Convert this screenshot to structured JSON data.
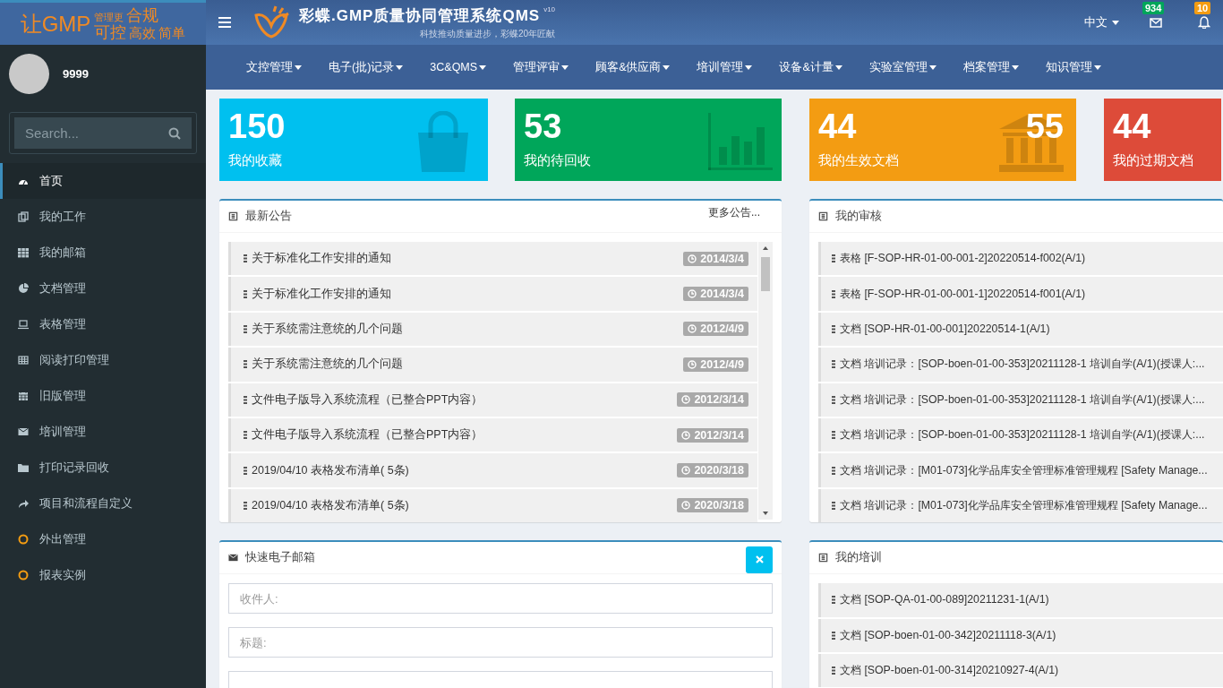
{
  "header": {
    "logo": {
      "lead": "让GMP",
      "small": "管理更",
      "big": "合规",
      "words": [
        "可控",
        "高效",
        "简单"
      ]
    },
    "app_title": "彩蝶.GMP质量协同管理系统QMS",
    "version": "v10",
    "slogan": "科技推动质量进步，彩蝶20年匠献",
    "language": "中文",
    "mail_count": "934",
    "alert_count": "10"
  },
  "user": {
    "name": "9999"
  },
  "search": {
    "placeholder": "Search..."
  },
  "sidebar": {
    "items": [
      {
        "label": "首页",
        "selected": true
      },
      {
        "label": "我的工作",
        "selected": false
      },
      {
        "label": "我的邮箱",
        "selected": false
      },
      {
        "label": "文档管理",
        "selected": false
      },
      {
        "label": "表格管理",
        "selected": false
      },
      {
        "label": "阅读打印管理",
        "selected": false
      },
      {
        "label": "旧版管理",
        "selected": false
      },
      {
        "label": "培训管理",
        "selected": false
      },
      {
        "label": "打印记录回收",
        "selected": false
      },
      {
        "label": "项目和流程自定义",
        "selected": false
      },
      {
        "label": "外出管理",
        "selected": false
      },
      {
        "label": "报表实例",
        "selected": false
      }
    ]
  },
  "nav": {
    "items": [
      "文控管理",
      "电子(批)记录",
      "3C&QMS",
      "管理评审",
      "顾客&供应商",
      "培训管理",
      "设备&计量",
      "实验室管理",
      "档案管理",
      "知识管理"
    ]
  },
  "stats": [
    {
      "value": "150",
      "label": "我的收藏",
      "color": "#00c0ef"
    },
    {
      "value": "53",
      "label": "我的待回收",
      "color": "#00a65a"
    },
    {
      "value": "44",
      "extra": "55",
      "label": "我的生效文档",
      "color": "#f39c12"
    },
    {
      "value": "44",
      "label": "我的过期文档",
      "color": "#dd4b39"
    }
  ],
  "announcements": {
    "title": "最新公告",
    "more": "更多公告...",
    "items": [
      {
        "text": "关于标准化工作安排的通知",
        "date": "2014/3/4"
      },
      {
        "text": "关于标准化工作安排的通知",
        "date": "2014/3/4"
      },
      {
        "text": "关于系统需注意统的几个问题",
        "date": "2012/4/9"
      },
      {
        "text": "关于系统需注意统的几个问题",
        "date": "2012/4/9"
      },
      {
        "text": "文件电子版导入系统流程（已整合PPT内容）",
        "date": "2012/3/14"
      },
      {
        "text": "文件电子版导入系统流程（已整合PPT内容）",
        "date": "2012/3/14"
      },
      {
        "text": "2019/04/10 表格发布清单( 5条)",
        "date": "2020/3/18"
      },
      {
        "text": "2019/04/10 表格发布清单( 5条)",
        "date": "2020/3/18"
      }
    ]
  },
  "reviews": {
    "title": "我的审核",
    "items": [
      "表格 [F-SOP-HR-01-00-001-2]20220514-f002(A/1)",
      "表格 [F-SOP-HR-01-00-001-1]20220514-f001(A/1)",
      "文档 [SOP-HR-01-00-001]20220514-1(A/1)",
      "文档 培训记录：[SOP-boen-01-00-353]20211128-1 培训自学(A/1)(授课人:...",
      "文档 培训记录：[SOP-boen-01-00-353]20211128-1 培训自学(A/1)(授课人:...",
      "文档 培训记录：[SOP-boen-01-00-353]20211128-1 培训自学(A/1)(授课人:...",
      "文档 培训记录：[M01-073]化学品库安全管理标准管理规程 [Safety Manage...",
      "文档 培训记录：[M01-073]化学品库安全管理标准管理规程 [Safety Manage..."
    ]
  },
  "quick_mail": {
    "title": "快速电子邮箱",
    "recipient_placeholder": "收件人:",
    "subject_placeholder": "标题:"
  },
  "training": {
    "title": "我的培训",
    "items": [
      "文档 [SOP-QA-01-00-089]20211231-1(A/1)",
      "文档 [SOP-boen-01-00-342]20211118-3(A/1)",
      "文档 [SOP-boen-01-00-314]20210927-4(A/1)"
    ]
  }
}
